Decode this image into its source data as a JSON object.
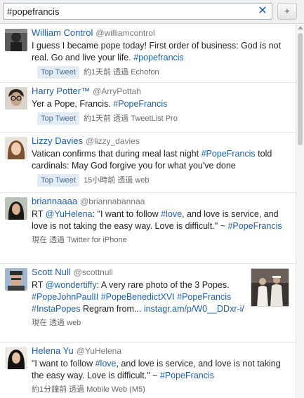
{
  "search": {
    "value": "#popefrancis"
  },
  "toolbar": {
    "clear_label": "✕",
    "add_label": "+"
  },
  "tweets": [
    {
      "display_name": "William Control",
      "handle": "@williamcontrol",
      "text_before": "I guess I became pope today! First order of business: God is not real. Go and live your life. ",
      "hashtag": "#popefrancis",
      "badge": "Top Tweet",
      "time": "約1天前",
      "via_label": "透過",
      "client": "Echofon"
    },
    {
      "display_name": "Harry Potter™",
      "handle": "@ArryPottah",
      "text_before": "Yer a Pope, Francis. ",
      "hashtag": "#PopeFrancis",
      "badge": "Top Tweet",
      "time": "約1天前",
      "via_label": "透過",
      "client": "TweetList Pro"
    },
    {
      "display_name": "Lizzy Davies",
      "handle": "@lizzy_davies",
      "text_before": "Vatican confirms that during meal last night ",
      "hashtag": "#PopeFrancis",
      "text_after": " told cardinals: May God forgive you for what you've done",
      "badge": "Top Tweet",
      "time": "15小時前",
      "via_label": "透過",
      "client": "web"
    },
    {
      "display_name": "briannaaaa",
      "handle": "@briannabannaa",
      "rt": "RT ",
      "mention": "@YuHelena",
      "text_a": ": \"I want to follow ",
      "hashtag_love": "#love",
      "text_b": ", and love is service, and love is not taking the easy way. Love is difficult.\" ~ ",
      "hashtag": "#PopeFrancis",
      "time": "現在",
      "via_label": "透過",
      "client": "Twitter for iPhone"
    },
    {
      "display_name": "Scott Null",
      "handle": "@scottnull",
      "rt": "RT ",
      "mention": "@wondertiffy",
      "text_a": ": A very rare photo of the 3 Popes. ",
      "hashtag_1": "#PopeJohnPaulII",
      "hashtag_2": "#PopeBenedictXVI",
      "hashtag_3": "#PopeFrancis",
      "hashtag_4": "#InstaPopes",
      "text_b": " Regram from...",
      "url": "instagr.am/p/W0__DDxr-i/",
      "time": "現在",
      "via_label": "透過",
      "client": "web"
    },
    {
      "display_name": "Helena Yu",
      "handle": "@YuHelena",
      "text_a": "\"I want to follow ",
      "hashtag_love": "#love",
      "text_b": ", and love is service, and love is not taking the easy way. Love is difficult.\" ~ ",
      "hashtag": "#PopeFrancis",
      "time": "約1分鐘前",
      "via_label": "透過",
      "client": "Mobile Web (M5)"
    }
  ]
}
